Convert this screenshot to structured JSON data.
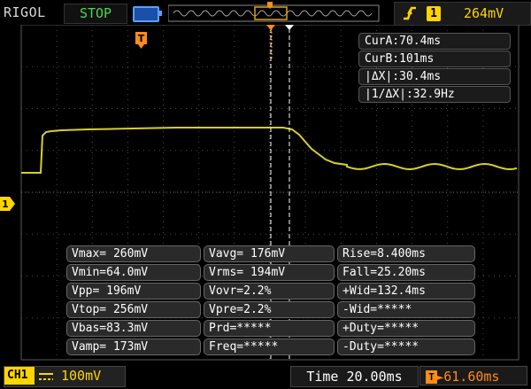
{
  "header": {
    "brand": "RIGOL",
    "run_state": "STOP",
    "trigger_edge_icon": "rising-edge-icon",
    "trigger_channel": "1",
    "trigger_level": "264mV"
  },
  "cursor_readout": {
    "cur_a": "CurA:70.4ms",
    "cur_b": "CurB:101ms",
    "delta_x": "|ΔX|:30.4ms",
    "inv_delta_x": "|1/ΔX|:32.9Hz"
  },
  "markers": {
    "trigger_position_label": "T",
    "channel_marker_label": "1"
  },
  "measurements": {
    "rows": [
      [
        "Vmax= 260mV",
        "Vavg= 176mV",
        "Rise=8.400ms"
      ],
      [
        "Vmin=64.0mV",
        "Vrms= 194mV",
        "Fall=25.20ms"
      ],
      [
        "Vpp= 196mV",
        "Vovr=2.2%",
        "+Wid=132.4ms"
      ],
      [
        "Vtop= 256mV",
        "Vpre=2.2%",
        "-Wid=*****"
      ],
      [
        "Vbas=83.3mV",
        "Prd=*****",
        "+Duty=*****"
      ],
      [
        "Vamp= 173mV",
        "Freq=*****",
        "-Duty=*****"
      ]
    ]
  },
  "footer": {
    "ch1_label": "CH1",
    "ch1_scale": "100mV",
    "timebase": "Time 20.00ms",
    "trigger_delay": "61.60ms"
  },
  "colors": {
    "trace": "#d6cf2a",
    "grid": "#4a4a4a",
    "accent_yellow": "#ffd400",
    "accent_orange": "#ff8c1a",
    "run_green": "#4bd84b",
    "cursor": "#ffffff"
  }
}
